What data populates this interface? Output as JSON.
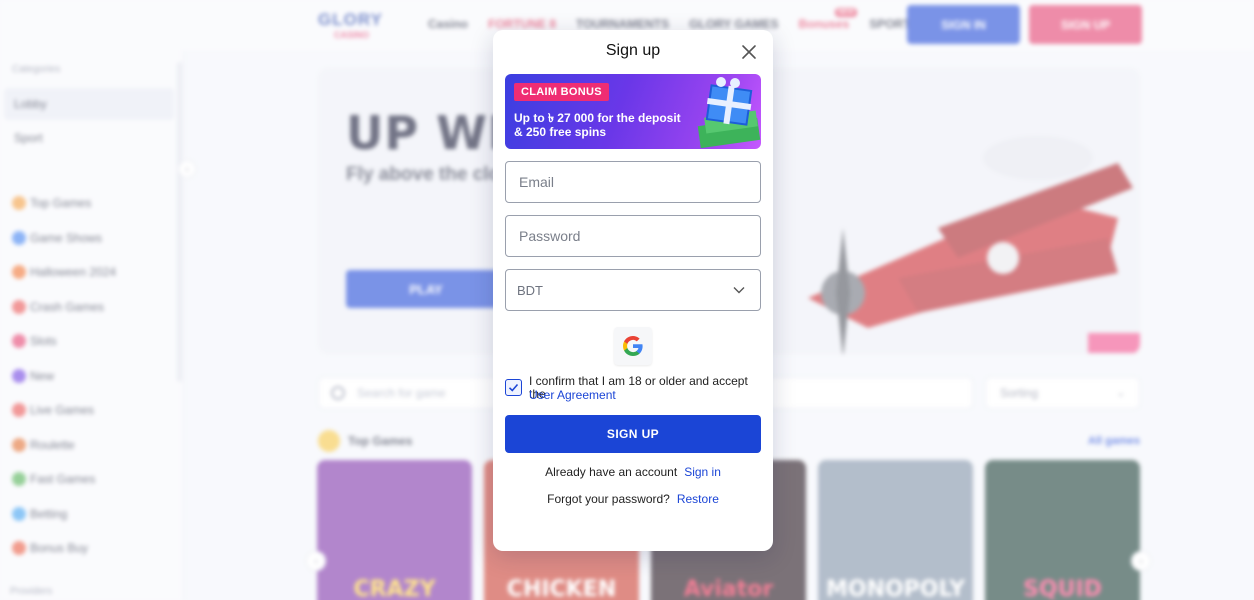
{
  "header": {
    "logo_top": "GLORY",
    "logo_bottom": "CASINO",
    "nav": [
      "Casino",
      "FORTUNE 8",
      "TOURNAMENTS",
      "GLORY GAMES",
      "Bonuses",
      "SPORT"
    ],
    "nav_new_badge": "NEW",
    "signin_label": "SIGN IN",
    "signup_label": "SIGN UP"
  },
  "sidebar": {
    "category_label": "Categories",
    "top_items": [
      "Lobby",
      "Sport"
    ],
    "items": [
      "Top Games",
      "Game Shows",
      "Halloween 2024",
      "Crash Games",
      "Slots",
      "New",
      "Live Games",
      "Roulette",
      "Fast Games",
      "Betting",
      "Bonus Buy"
    ],
    "footer_label": "Providers",
    "colors": [
      "#f29b3c",
      "#3b7ef0",
      "#f06f2c",
      "#e84f4f",
      "#e33b6c",
      "#6b3ce0",
      "#e84f4f",
      "#e06b2c",
      "#4caf50",
      "#3b9ef0",
      "#e8553c"
    ]
  },
  "banner": {
    "title": "UP WITH",
    "subtitle": "Fly above the clouds",
    "button": "PLAY"
  },
  "games": {
    "search_placeholder": "Search for game",
    "sort_label": "Sorting",
    "section_title": "Top Games",
    "all_games": "All games",
    "cards": [
      {
        "name": "CRAZY",
        "bg": "#7b2fa8",
        "fg": "#ffd23c"
      },
      {
        "name": "CHICKEN",
        "bg": "#c93a2e",
        "fg": "#ffffff"
      },
      {
        "name": "Aviator",
        "bg": "#1c0d18",
        "fg": "#e8234a"
      },
      {
        "name": "MONOPOLY",
        "bg": "#7d8fa6",
        "fg": "#ffffff"
      },
      {
        "name": "SQUID",
        "bg": "#153a33",
        "fg": "#ff3c7a"
      }
    ]
  },
  "modal": {
    "title": "Sign up",
    "bonus_tag": "CLAIM BONUS",
    "bonus_text": "Up to ৳ 27 000 for the deposit & 250 free spins",
    "email_placeholder": "Email",
    "password_placeholder": "Password",
    "currency": "BDT",
    "agree_text": "I confirm that I am 18 or older and accept the",
    "agree_link": "User Agreement",
    "submit_label": "SIGN UP",
    "have_account": "Already have an account",
    "signin_link": "Sign in",
    "forgot_text": "Forgot your password?",
    "restore_link": "Restore",
    "colors": {
      "accent": "#1b45d6",
      "bonus_tag": "#ef2d73"
    }
  }
}
